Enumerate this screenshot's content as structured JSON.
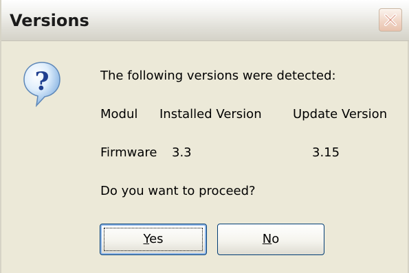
{
  "dialog": {
    "title": "Versions",
    "close_icon": "close-icon",
    "info_icon": "question-icon",
    "intro": "The following versions were detected:",
    "columns": [
      "Modul",
      "Installed Version",
      "Update Version"
    ],
    "row": {
      "module": "Firmware",
      "installed": "3.3",
      "update": "3.15"
    },
    "prompt": "Do you want to proceed?",
    "buttons": {
      "yes": {
        "mnemonic": "Y",
        "rest": "es"
      },
      "no": {
        "mnemonic": "N",
        "rest": "o"
      }
    }
  },
  "colors": {
    "face": "#ece9d8",
    "button_border": "#003c74",
    "close_accent": "#c65b3c"
  }
}
